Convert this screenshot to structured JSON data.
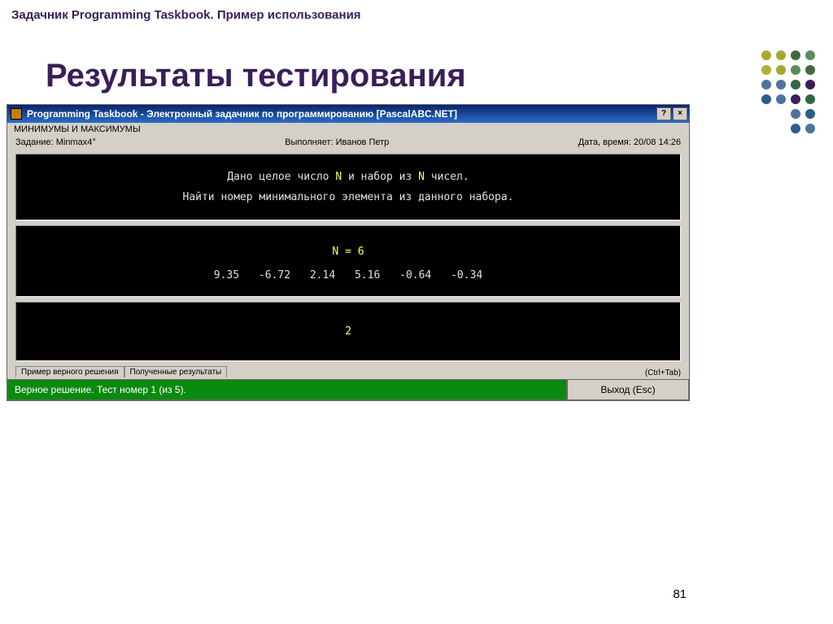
{
  "slide": {
    "header": "Задачник Programming Taskbook. Пример использования",
    "title": "Результаты тестирования",
    "page": "81"
  },
  "window": {
    "title": "Programming Taskbook - Электронный задачник по программированию [PascalABC.NET]",
    "help_btn": "?",
    "close_btn": "×"
  },
  "header": {
    "section": "МИНИМУМЫ И МАКСИМУМЫ",
    "task_label": "Задание: Minmax4°",
    "user_label": "Выполняет: Иванов Петр",
    "datetime_label": "Дата, время: 20/08 14:26"
  },
  "problem": {
    "line1_pre": "Дано целое число ",
    "line1_n1": "N",
    "line1_mid": " и набор из ",
    "line1_n2": "N",
    "line1_post": " чисел.",
    "line2": "Найти номер минимального элемента из данного набора."
  },
  "input": {
    "n_expr": "N = 6",
    "values": "9.35  -6.72  2.14  5.16  -0.64  -0.34"
  },
  "output": {
    "answer": "2"
  },
  "tabs": {
    "tab1": "Пример верного решения",
    "tab2": "Полученные результаты",
    "hint": "(Ctrl+Tab)"
  },
  "status": {
    "msg": "Верное решение. Тест номер 1 (из 5).",
    "exit": "Выход (Esc)"
  }
}
